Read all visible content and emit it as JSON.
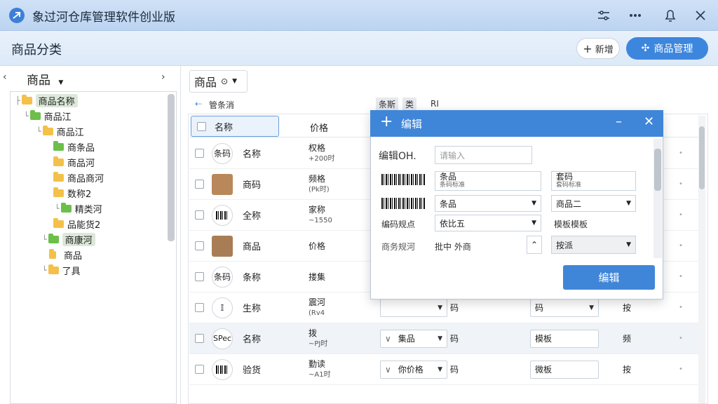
{
  "window": {
    "title": "象过河仓库管理软件创业版"
  },
  "header": {
    "section_title": "商品分类",
    "add_label": "新增",
    "mgmt_label": "商品管理"
  },
  "tree": {
    "header": "商品",
    "items": [
      {
        "label": "商品名称",
        "folder": "yellow",
        "selected": true
      },
      {
        "label": "商品江",
        "folder": "green"
      },
      {
        "label": "商品江",
        "folder": "yellow"
      },
      {
        "label": "商条品",
        "folder": "green"
      },
      {
        "label": "商品河",
        "folder": "yellow"
      },
      {
        "label": "商品商河",
        "folder": "yellow"
      },
      {
        "label": "数称2",
        "folder": "yellow"
      },
      {
        "label": "精类河",
        "folder": "green"
      },
      {
        "label": "品能货2",
        "folder": "yellow"
      },
      {
        "label": "商康河",
        "folder": "green",
        "selected": true
      },
      {
        "label": "商品",
        "folder": "yellow"
      },
      {
        "label": "了具",
        "folder": "yellow"
      }
    ]
  },
  "toolbar": {
    "combo_label": "商品",
    "filter_label": "管条消",
    "filter_col1": "条斯",
    "filter_col2": "类",
    "filter_col3": "RI"
  },
  "table": {
    "headers": {
      "name": "名称",
      "price": "价格"
    },
    "rows": [
      {
        "thumb": "条码",
        "name": "名称",
        "price": "权格",
        "sub": "+200时",
        "sel1": "",
        "sel2": "",
        "c3": "",
        "c4": ""
      },
      {
        "thumb": "img",
        "name": "商码",
        "price": "频格",
        "sub": "(Pk时)",
        "sel1": "",
        "sel2": "",
        "c3": "",
        "c4": ""
      },
      {
        "thumb": "barcode",
        "name": "全称",
        "price": "家称",
        "sub": "~1550",
        "sel1": "",
        "sel2": "",
        "c3": "",
        "c4": ""
      },
      {
        "thumb": "img",
        "name": "商品",
        "price": "价格",
        "sub": "",
        "sel1": "",
        "sel2": "",
        "c3": "",
        "c4": ""
      },
      {
        "thumb": "条码",
        "name": "条称",
        "price": "搂集",
        "sub": "",
        "sel1": "",
        "sel2": "",
        "c3": "",
        "c4": ""
      },
      {
        "thumb": "barcode",
        "name": "生称",
        "price": "震河",
        "sub": "(Rv4",
        "sel1": "",
        "sel2": "码",
        "c3": "码",
        "c4": "按"
      },
      {
        "thumb": "SPec",
        "name": "名称",
        "price": "拨",
        "sub": "~PJ时",
        "sel1": "集品",
        "sel2": "码",
        "c3": "模板",
        "c4": "频"
      },
      {
        "thumb": "barcode",
        "name": "验货",
        "price": "勤读",
        "sub": "~A1时",
        "sel1": "你价格",
        "sel2": "码",
        "c3": "微板",
        "c4": "按"
      }
    ]
  },
  "dialog": {
    "title": "编辑",
    "field1_label": "编辑OH.",
    "field1_placeholder": "请输入",
    "row2_a": "条品",
    "row2_a_sub": "条码标准",
    "row2_b": "套码",
    "row2_b_sub": "套码标准",
    "row3_a": "条品",
    "row3_b": "商品二",
    "row4_label": "编码规点",
    "row4_a": "依比五",
    "row4_b": "模板模板",
    "row5_label": "商务规河",
    "row5_a": "批中 外商",
    "row5_b": "按派",
    "button": "编辑"
  },
  "colors": {
    "accent": "#3f86d9",
    "folder_yellow": "#f3c14a",
    "folder_green": "#6cbf4a"
  }
}
